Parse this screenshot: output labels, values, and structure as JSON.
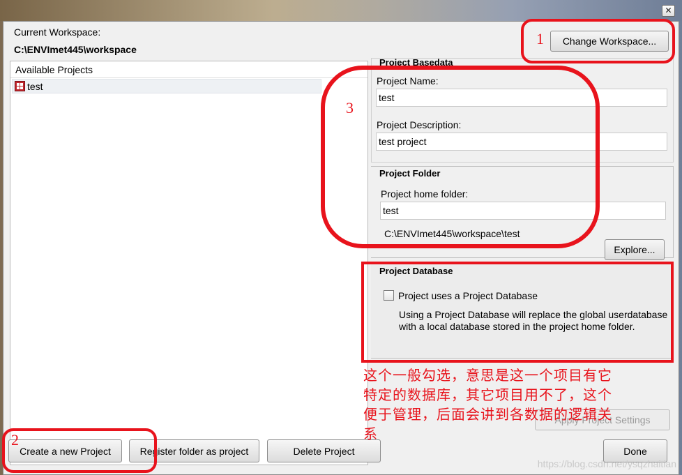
{
  "dialog": {
    "close_glyph": "✕"
  },
  "workspace": {
    "label": "Current Workspace:",
    "path": "C:\\ENVImet445\\workspace",
    "change_button": "Change Workspace..."
  },
  "projects": {
    "header": "Available Projects",
    "items": [
      "test"
    ],
    "icon": "project-grid-icon"
  },
  "basedata": {
    "title": "Project Basedata",
    "name_label": "Project Name:",
    "name_value": "test",
    "description_label": "Project Description:",
    "description_value": "test project"
  },
  "folder": {
    "title": "Project Folder",
    "home_label": "Project home folder:",
    "home_value": "test",
    "full_path": "C:\\ENVImet445\\workspace\\test",
    "explore_button": "Explore..."
  },
  "database": {
    "title": "Project Database",
    "checkbox_label": "Project uses a Project Database",
    "checked": false,
    "help_line1": "Using a Project Database will replace the global userdatabase",
    "help_line2": "with a local database stored in the project home folder."
  },
  "buttons": {
    "apply": "Apply Project Settings",
    "create": "Create a new Project",
    "register": "Register folder as project",
    "delete": "Delete Project",
    "done": "Done"
  },
  "annotations": {
    "num1": "1",
    "num2": "2",
    "num3": "3",
    "note_line1": "这个一般勾选，意思是这一个项目有它",
    "note_line2": "特定的数据库，其它项目用不了，这个",
    "note_line3": "便于管理，后面会讲到各数据的逻辑关",
    "note_line4": "系",
    "color": "#e8131c"
  },
  "watermark": "https://blog.csdn.net/ysqzhaitian"
}
